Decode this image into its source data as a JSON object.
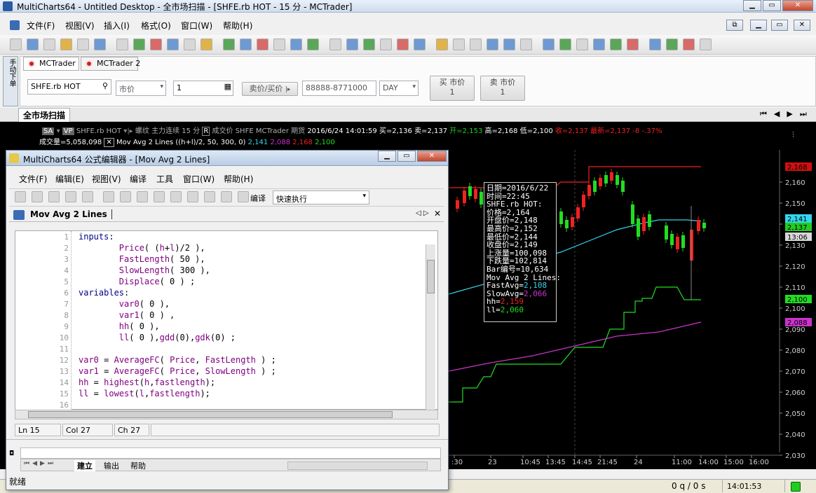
{
  "window": {
    "title": "MultiCharts64 - Untitled Desktop - 全市场扫描 - [SHFE.rb HOT - 15 分 - MCTrader]"
  },
  "menu": {
    "items": [
      "文件(F)",
      "视图(V)",
      "插入(I)",
      "格式(O)",
      "窗口(W)",
      "帮助(H)"
    ]
  },
  "trade_panel": {
    "side_label": "手动下单",
    "tabs": [
      "MCTrader",
      "MCTrader 2"
    ],
    "symbol": "SHFE.rb HOT",
    "order_type": "市价",
    "quantity": "1",
    "sell_buy": "卖价/买价",
    "account": "88888-8771000",
    "tif": "DAY",
    "buy_market": "买 市价",
    "buy_qty": "1",
    "sell_market": "卖 市价",
    "sell_qty": "1"
  },
  "workspace_tab": "全市场扫描",
  "chart": {
    "header1": {
      "sa": "SA",
      "vp": "VP",
      "symbol": "SHFE.rb HOT",
      "name": "螺纹 主力连续",
      "res": "15 分",
      "r": "R",
      "desc": "成交价",
      "exch": "SHFE",
      "broker": "MCTrader",
      "date_label": "期货",
      "date": "2016/6/24",
      "time": "14:01:59",
      "buy": "买=2,136",
      "sell": "卖=2,137",
      "open": "开=2,153",
      "high": "高=2,168",
      "low": "低=2,100",
      "close": "收=2,137",
      "last": "最新=2,137",
      "chg": "-8",
      "pct": "-.37%"
    },
    "header2": {
      "volume": "成交量=5,058,098",
      "study": "Mov Avg 2 Lines",
      "params": "((h+l)/2, 50, 300, 0)",
      "v1": "2,141",
      "v2": "2,088",
      "v3": "2,168",
      "v4": "2,100"
    },
    "hint": [
      "日期=2016/6/22",
      "时间=22:45",
      "SHFE.rb HOT:",
      "价格=2,164",
      "开盘价=2,148",
      "最高价=2,152",
      "最低价=2,144",
      "收盘价=2,149",
      "上涨量=100,098",
      "下跌量=102,814",
      "Bar编号=10,634",
      "Mov Avg 2 Lines:",
      "FastAvg=2,108",
      "SlowAvg=2,066",
      "hh=2,159",
      "ll=2,060"
    ],
    "y_ticks": [
      "2,160",
      "2,150",
      "2,140",
      "2,130",
      "2,120",
      "2,110",
      "2,100",
      "2,090",
      "2,080",
      "2,070",
      "2,060",
      "2,050",
      "2,040",
      "2,030"
    ],
    "x_ticks": [
      ":30",
      "23",
      "10:45",
      "13:45",
      "14:45",
      "21:45",
      "24",
      "11:00",
      "14:00",
      "15:00",
      "16:00"
    ],
    "price_tags": [
      {
        "text": "2,168",
        "color": "#d01010"
      },
      {
        "text": "2,141",
        "color": "#33d6ee"
      },
      {
        "text": "2,137",
        "color": "#22cc22"
      },
      {
        "text": "13:06",
        "color": "#d8d8d8"
      },
      {
        "text": "2,100",
        "color": "#22dd22"
      },
      {
        "text": "2,088",
        "color": "#cc33cc"
      }
    ]
  },
  "editor": {
    "title": "MultiCharts64 公式编辑器 - [Mov Avg 2 Lines]",
    "menu": [
      "文件(F)",
      "编辑(E)",
      "视图(V)",
      "编译",
      "工具",
      "窗口(W)",
      "帮助(H)"
    ],
    "compile_label": "编译",
    "run_mode": "快速执行",
    "doc_tab": "Mov Avg 2 Lines",
    "lines": [
      "inputs:",
      "        Price( (h+l)/2 ),",
      "        FastLength( 50 ),",
      "        SlowLength( 300 ),",
      "        Displace( 0 ) ;",
      "variables:",
      "        var0( 0 ),",
      "        var1( 0 ) ,",
      "        hh( 0 ),",
      "        ll( 0 ),gdd(0),gdk(0) ;",
      "",
      "var0 = AverageFC( Price, FastLength ) ;",
      "var1 = AverageFC( Price, SlowLength ) ;",
      "hh = highest(h,fastlength);",
      "ll = lowest(l,fastlength);",
      ""
    ],
    "status": {
      "ln": "Ln 15",
      "col": "Col 27",
      "ch": "Ch 27"
    },
    "bottom_tabs": [
      "建立",
      "输出",
      "帮助"
    ],
    "ready": "就绪"
  },
  "statusbar": {
    "queue": "0 q / 0 s",
    "time": "14:01:53"
  }
}
